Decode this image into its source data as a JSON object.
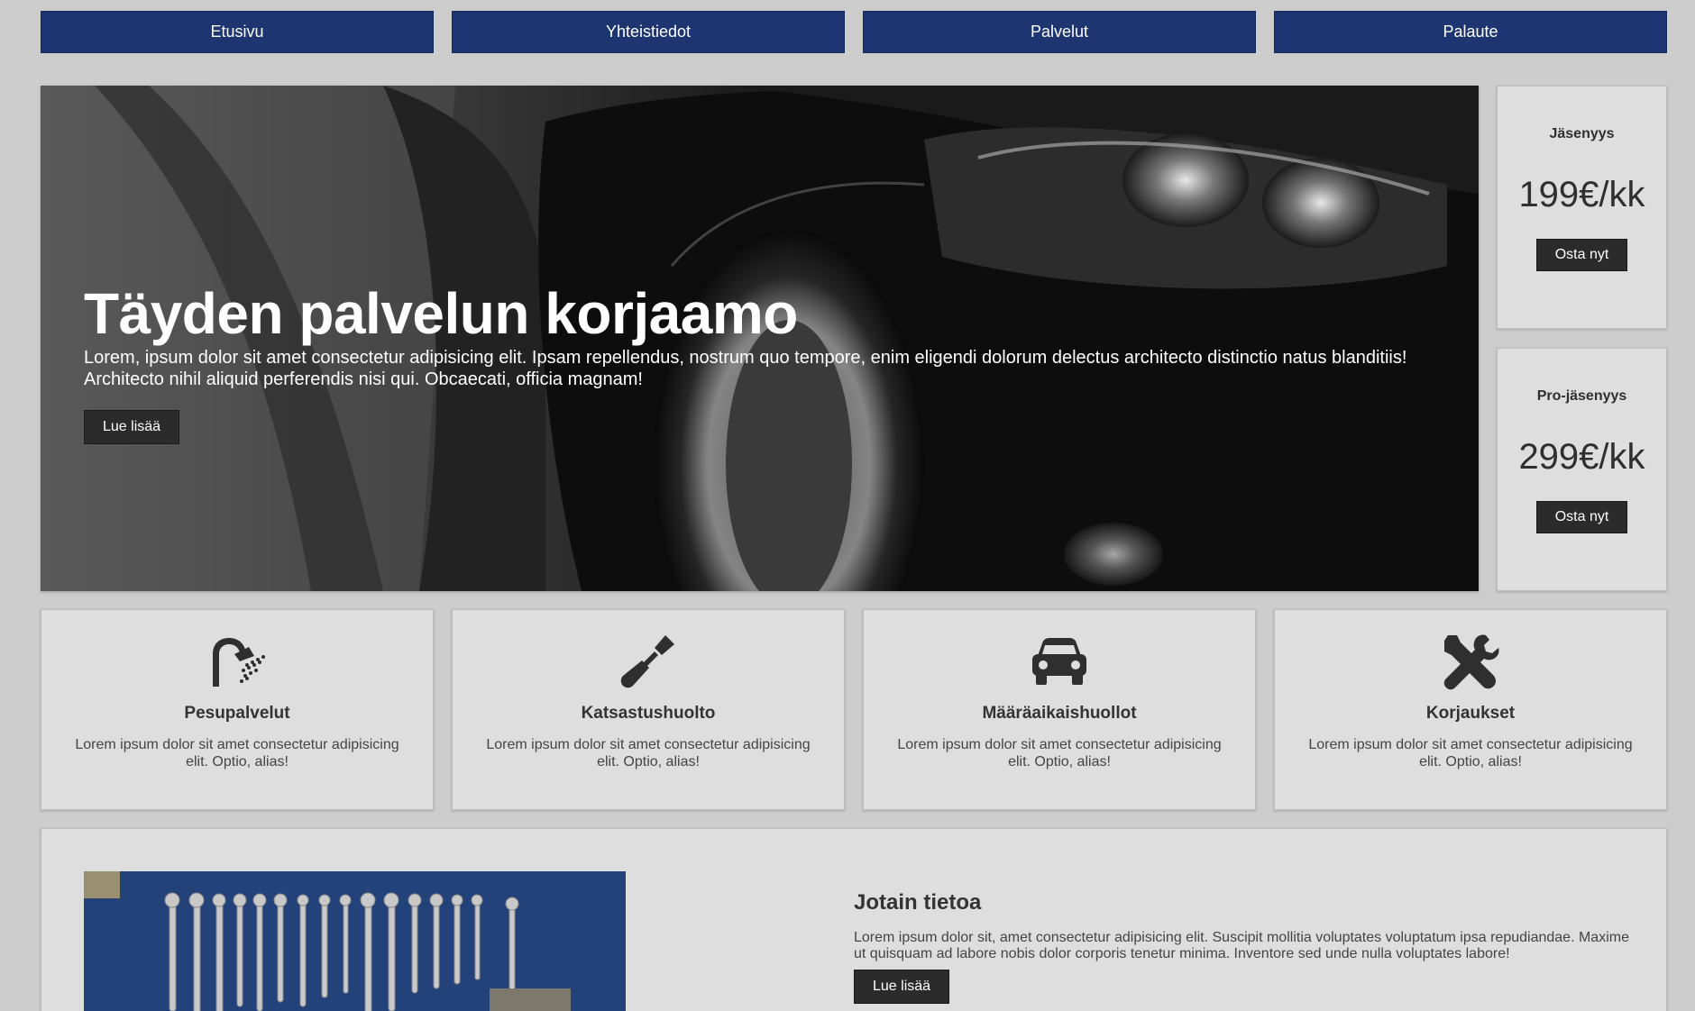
{
  "nav": {
    "items": [
      "Etusivu",
      "Yhteistiedot",
      "Palvelut",
      "Palaute"
    ]
  },
  "hero": {
    "title": "Täyden palvelun korjaamo",
    "text": "Lorem, ipsum dolor sit amet consectetur adipisicing elit. Ipsam repellendus, nostrum quo tempore, enim eligendi dolorum delectus architecto distinctio natus blanditiis! Architecto nihil aliquid perferendis nisi qui. Obcaecati, officia magnam!",
    "button": "Lue lisää"
  },
  "plans": [
    {
      "name": "Jäsenyys",
      "price": "199€/kk",
      "button": "Osta nyt"
    },
    {
      "name": "Pro-jäsenyys",
      "price": "299€/kk",
      "button": "Osta nyt"
    }
  ],
  "services": [
    {
      "icon": "shower-icon",
      "title": "Pesupalvelut",
      "text": "Lorem ipsum dolor sit amet consectetur adipisicing elit. Optio, alias!"
    },
    {
      "icon": "screwdriver-icon",
      "title": "Katsastushuolto",
      "text": "Lorem ipsum dolor sit amet consectetur adipisicing elit. Optio, alias!"
    },
    {
      "icon": "car-icon",
      "title": "Määräaikaishuollot",
      "text": "Lorem ipsum dolor sit amet consectetur adipisicing elit. Optio, alias!"
    },
    {
      "icon": "tools-icon",
      "title": "Korjaukset",
      "text": "Lorem ipsum dolor sit amet consectetur adipisicing elit. Optio, alias!"
    }
  ],
  "about": {
    "title": "Jotain tietoa",
    "text": "Lorem ipsum dolor sit, amet consectetur adipisicing elit. Suscipit mollitia voluptates voluptatum ipsa repudiandae. Maxime ut quisquam ad labore nobis dolor corporis tenetur minima. Inventore sed unde nulla voluptates labore!",
    "button": "Lue lisää"
  },
  "colors": {
    "background": "#cdcdcd",
    "nav": "#1d3570",
    "card": "#dedede",
    "button": "#2b2b2b"
  }
}
